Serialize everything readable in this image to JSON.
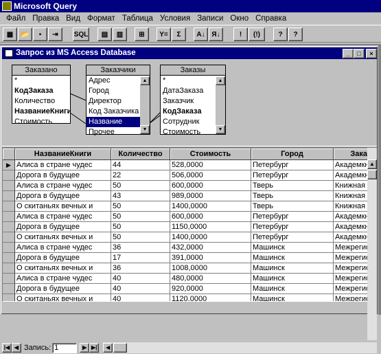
{
  "app": {
    "title": "Microsoft Query"
  },
  "menu": [
    "Файл",
    "Правка",
    "Вид",
    "Формат",
    "Таблица",
    "Условия",
    "Записи",
    "Окно",
    "Справка"
  ],
  "toolbar": {
    "sql_label": "SQL",
    "sigma": "Σ",
    "filter": "Y=",
    "az_sort": "A↓",
    "za_sort": "Я↓",
    "bang": "!",
    "auto": "(!)",
    "help_arrow": "?",
    "help": "?"
  },
  "child": {
    "title": "Запрос из MS Access Database",
    "min": "_",
    "max": "□",
    "close": "×"
  },
  "tables": [
    {
      "name": "Заказано",
      "fields": [
        {
          "label": "*",
          "key": false
        },
        {
          "label": "КодЗаказа",
          "key": true
        },
        {
          "label": "Количество",
          "key": false
        },
        {
          "label": "НазваниеКниги",
          "key": true
        },
        {
          "label": "Стоимость",
          "key": false
        }
      ]
    },
    {
      "name": "Заказчики",
      "fields": [
        {
          "label": "Адрес",
          "key": false
        },
        {
          "label": "Город",
          "key": false
        },
        {
          "label": "Директор",
          "key": false
        },
        {
          "label": "Код Заказчика",
          "key": false
        },
        {
          "label": "Название",
          "key": false,
          "selected": true
        },
        {
          "label": "Прочее",
          "key": false
        }
      ]
    },
    {
      "name": "Заказы",
      "fields": [
        {
          "label": "*",
          "key": false
        },
        {
          "label": "ДатаЗаказа",
          "key": false
        },
        {
          "label": "Заказчик",
          "key": false
        },
        {
          "label": "КодЗаказа",
          "key": true
        },
        {
          "label": "Сотрудник",
          "key": false
        },
        {
          "label": "Стоимость",
          "key": false
        }
      ]
    }
  ],
  "grid": {
    "columns": [
      "НазваниеКниги",
      "Количество",
      "Стоимость",
      "Город",
      "Заказ"
    ],
    "rows": [
      [
        "Алиса в стране чудес",
        "44",
        "528,0000",
        "Петербург",
        "Академкнига"
      ],
      [
        "Дорога в будущее",
        "22",
        "506,0000",
        "Петербург",
        "Академкнига"
      ],
      [
        "Алиса в стране чудес",
        "50",
        "600,0000",
        "Тверь",
        "Книжная лавка"
      ],
      [
        "Дорога в будущее",
        "43",
        "989,0000",
        "Тверь",
        "Книжная лавка"
      ],
      [
        "О скитаньях вечных и",
        "50",
        "1400,0000",
        "Тверь",
        "Книжная лавка"
      ],
      [
        "Алиса в стране чудес",
        "50",
        "600,0000",
        "Петербург",
        "Академкнига"
      ],
      [
        "Дорога в будущее",
        "50",
        "1150,0000",
        "Петербург",
        "Академкнига"
      ],
      [
        "О скитаньях вечных и",
        "50",
        "1400,0000",
        "Петербург",
        "Академкнига"
      ],
      [
        "Алиса в стране чудес",
        "36",
        "432,0000",
        "Машинск",
        "Межрегиональн"
      ],
      [
        "Дорога в будущее",
        "17",
        "391,0000",
        "Машинск",
        "Межрегиональн"
      ],
      [
        "О скитаньях вечных и",
        "36",
        "1008,0000",
        "Машинск",
        "Межрегиональн"
      ],
      [
        "Алиса в стране чудес",
        "40",
        "480,0000",
        "Машинск",
        "Межрегиональн"
      ],
      [
        "Дорога в будущее",
        "40",
        "920,0000",
        "Машинск",
        "Межрегиональн"
      ],
      [
        "О скитаньях вечных и",
        "40",
        "1120,0000",
        "Машинск",
        "Межрегиональн"
      ]
    ]
  },
  "nav": {
    "record_label": "Запись:",
    "record_value": "1"
  }
}
